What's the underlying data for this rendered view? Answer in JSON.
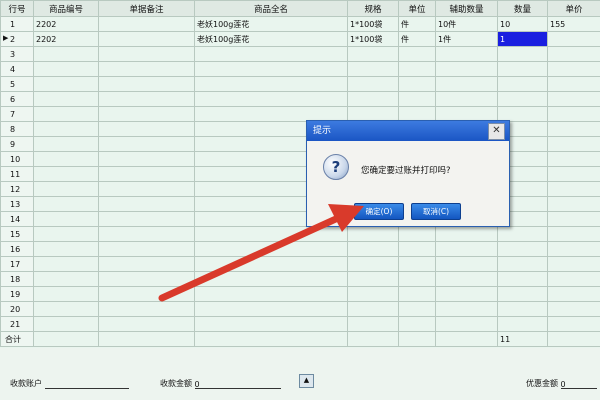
{
  "grid": {
    "headers": [
      "行号",
      "商品编号",
      "单据备注",
      "商品全名",
      "规格",
      "单位",
      "辅助数量",
      "数量",
      "单价"
    ],
    "rows": [
      {
        "no": "1",
        "code": "2202",
        "note": "",
        "name": "老妖100g莲花",
        "spec": "1*100袋",
        "unit": "件",
        "aux": "10件",
        "qty": "10",
        "price": "155"
      },
      {
        "no": "2",
        "code": "2202",
        "note": "",
        "name": "老妖100g莲花",
        "spec": "1*100袋",
        "unit": "件",
        "aux": "1件",
        "qty": "1",
        "price": ""
      },
      {
        "no": "3"
      },
      {
        "no": "4"
      },
      {
        "no": "5"
      },
      {
        "no": "6"
      },
      {
        "no": "7"
      },
      {
        "no": "8"
      },
      {
        "no": "9"
      },
      {
        "no": "10"
      },
      {
        "no": "11"
      },
      {
        "no": "12"
      },
      {
        "no": "13"
      },
      {
        "no": "14"
      },
      {
        "no": "15"
      },
      {
        "no": "16"
      },
      {
        "no": "17"
      },
      {
        "no": "18"
      },
      {
        "no": "19"
      },
      {
        "no": "20"
      },
      {
        "no": "21"
      }
    ],
    "total_label": "合计",
    "total_qty": "11",
    "row_pointer": "▶"
  },
  "footer": {
    "account_label": "收款账户",
    "amount_label": "收款金额",
    "amount_value": "0",
    "discount_label": "优惠金额",
    "discount_value": "0",
    "updown_glyph": "▲"
  },
  "dialog": {
    "title": "提示",
    "close_glyph": "✕",
    "icon_glyph": "?",
    "message": "您确定要过账并打印吗?",
    "ok_label": "确定(O)",
    "cancel_label": "取消(C)"
  },
  "colors": {
    "selection": "#1a1fe0",
    "arrow": "#d93a2b",
    "dialog_title": "#1a55c4"
  }
}
